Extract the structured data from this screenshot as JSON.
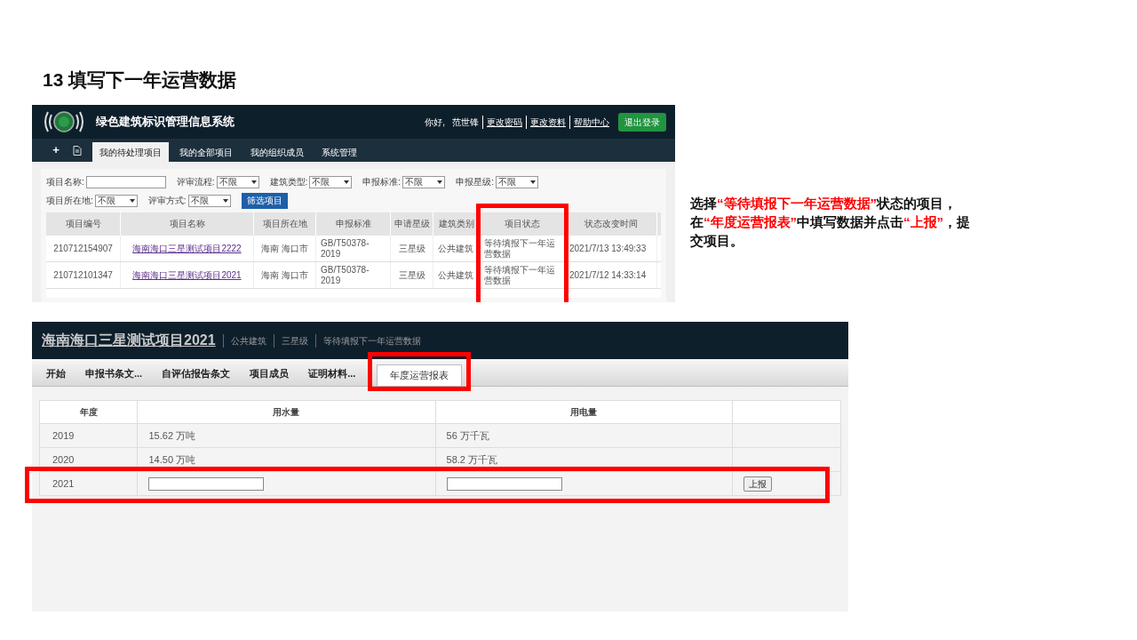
{
  "slide_title": "13 填写下一年运营数据",
  "screenshot_1": {
    "new_button": "+",
    "app_title": "绿色建筑标识管理信息系统",
    "greeting": "你好,",
    "user": "范世锋",
    "header_links": [
      "更改密码",
      "更改资料",
      "帮助中心"
    ],
    "logout_button": "退出登录",
    "nav": [
      {
        "label": "我的待处理项目",
        "selected": true
      },
      {
        "label": "我的全部项目",
        "selected": false
      },
      {
        "label": "我的组织成员",
        "selected": false
      },
      {
        "label": "系统管理",
        "selected": false
      }
    ],
    "filter_rows": [
      [
        {
          "kind": "text",
          "label": "项目名称:"
        },
        {
          "kind": "select",
          "label": "评审流程:",
          "value": "不限"
        },
        {
          "kind": "select",
          "label": "建筑类型:",
          "value": "不限"
        },
        {
          "kind": "select",
          "label": "申报标准:",
          "value": "不限"
        },
        {
          "kind": "select",
          "label": "申报星级:",
          "value": "不限"
        }
      ],
      [
        {
          "kind": "select",
          "label": "项目所在地:",
          "value": "不限"
        },
        {
          "kind": "select",
          "label": "评审方式:",
          "value": "不限"
        },
        {
          "kind": "button",
          "label": "筛选项目"
        }
      ]
    ],
    "table": {
      "columns": [
        {
          "label": "项目编号",
          "highlighted": false
        },
        {
          "label": "项目名称",
          "highlighted": false
        },
        {
          "label": "项目所在地",
          "highlighted": false
        },
        {
          "label": "申报标准",
          "highlighted": false
        },
        {
          "label": "申请星级",
          "highlighted": false
        },
        {
          "label": "建筑类别",
          "highlighted": false
        },
        {
          "label": "项目状态",
          "highlighted": true
        },
        {
          "label": "状态改变时间",
          "highlighted": false
        }
      ],
      "rows": [
        [
          "210712154907",
          "海南海口三星测试项目2222",
          "海南 海口市",
          "GB/T50378-2019",
          "三星级",
          "公共建筑",
          "等待填报下一年运营数据",
          "2021/7/13 13:49:33"
        ],
        [
          "210712101347",
          "海南海口三星测试项目2021",
          "海南 海口市",
          "GB/T50378-2019",
          "三星级",
          "公共建筑",
          "等待填报下一年运营数据",
          "2021/7/12 14:33:14"
        ]
      ]
    }
  },
  "instruction": [
    {
      "text": "选择",
      "highlighted": false
    },
    {
      "text": "“等待填报下一年运营数据”",
      "highlighted": true
    },
    {
      "text": "状态的项目，在",
      "highlighted": false
    },
    {
      "text": "“年度运营报表”",
      "highlighted": true
    },
    {
      "text": "中填写数据并点击",
      "highlighted": false
    },
    {
      "text": "“上报”",
      "highlighted": true
    },
    {
      "text": "，提交项目。",
      "highlighted": false
    }
  ],
  "screenshot_2": {
    "project_title": "海南海口三星测试项目2021",
    "project_tags": [
      "公共建筑",
      "三星级",
      "等待填报下一年运营数据"
    ],
    "tabs": [
      {
        "label": "开始",
        "selected": false,
        "highlighted": false
      },
      {
        "label": "申报书条文...",
        "selected": false,
        "highlighted": false
      },
      {
        "label": "自评估报告条文",
        "selected": false,
        "highlighted": false
      },
      {
        "label": "项目成员",
        "selected": false,
        "highlighted": false
      },
      {
        "label": "证明材料...",
        "selected": false,
        "highlighted": false
      },
      {
        "label": "年度运营报表",
        "selected": true,
        "highlighted": true
      }
    ],
    "table": {
      "columns": [
        "年度",
        "用水量",
        "用电量"
      ],
      "rows": [
        {
          "kind": "data",
          "highlighted": false,
          "year": "2019",
          "water": "15.62 万吨",
          "power": "56 万千瓦"
        },
        {
          "kind": "data",
          "highlighted": false,
          "year": "2020",
          "water": "14.50 万吨",
          "power": "58.2 万千瓦"
        },
        {
          "kind": "entry",
          "highlighted": true,
          "year": "2021",
          "submit_button": "上报"
        }
      ]
    }
  }
}
